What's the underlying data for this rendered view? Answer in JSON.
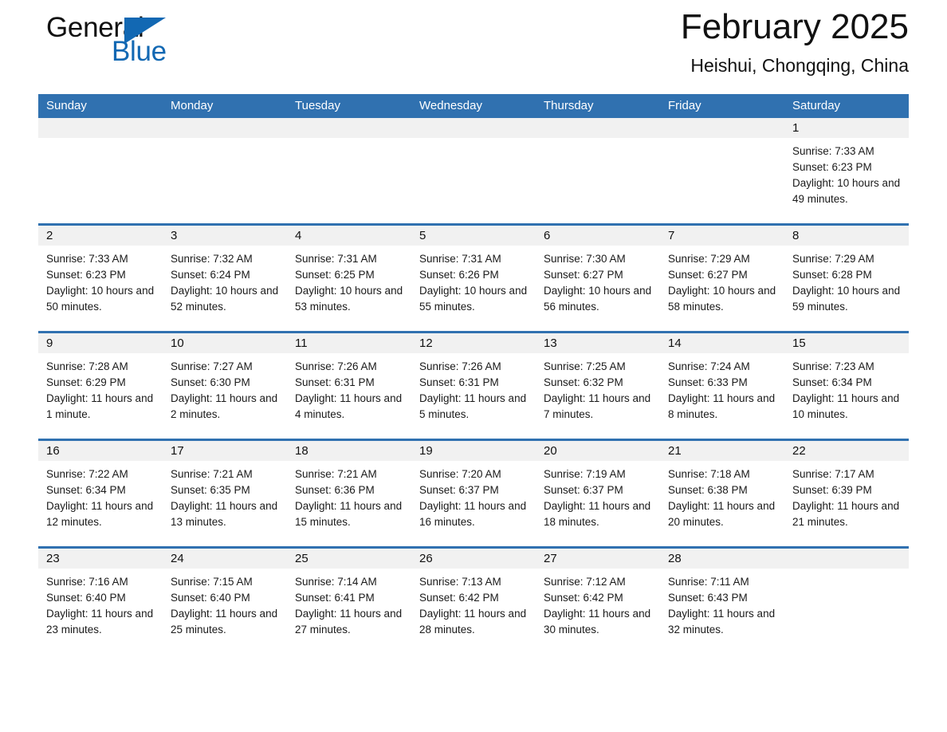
{
  "brand": {
    "name_dark": "General",
    "name_light": "Blue",
    "logo_icon": "blue-triangle-icon",
    "dark_color": "#111111",
    "blue_color": "#1268b3"
  },
  "header": {
    "month_title": "February 2025",
    "location": "Heishui, Chongqing, China"
  },
  "theme": {
    "header_blue": "#3071b0",
    "day_band_gray": "#f1f1f1",
    "text_color": "#1a1a1a"
  },
  "weekdays": [
    "Sunday",
    "Monday",
    "Tuesday",
    "Wednesday",
    "Thursday",
    "Friday",
    "Saturday"
  ],
  "weeks": [
    [
      {
        "day": "",
        "empty": true
      },
      {
        "day": "",
        "empty": true
      },
      {
        "day": "",
        "empty": true
      },
      {
        "day": "",
        "empty": true
      },
      {
        "day": "",
        "empty": true
      },
      {
        "day": "",
        "empty": true
      },
      {
        "day": "1",
        "sunrise": "Sunrise: 7:33 AM",
        "sunset": "Sunset: 6:23 PM",
        "daylight": "Daylight: 10 hours and 49 minutes."
      }
    ],
    [
      {
        "day": "2",
        "sunrise": "Sunrise: 7:33 AM",
        "sunset": "Sunset: 6:23 PM",
        "daylight": "Daylight: 10 hours and 50 minutes."
      },
      {
        "day": "3",
        "sunrise": "Sunrise: 7:32 AM",
        "sunset": "Sunset: 6:24 PM",
        "daylight": "Daylight: 10 hours and 52 minutes."
      },
      {
        "day": "4",
        "sunrise": "Sunrise: 7:31 AM",
        "sunset": "Sunset: 6:25 PM",
        "daylight": "Daylight: 10 hours and 53 minutes."
      },
      {
        "day": "5",
        "sunrise": "Sunrise: 7:31 AM",
        "sunset": "Sunset: 6:26 PM",
        "daylight": "Daylight: 10 hours and 55 minutes."
      },
      {
        "day": "6",
        "sunrise": "Sunrise: 7:30 AM",
        "sunset": "Sunset: 6:27 PM",
        "daylight": "Daylight: 10 hours and 56 minutes."
      },
      {
        "day": "7",
        "sunrise": "Sunrise: 7:29 AM",
        "sunset": "Sunset: 6:27 PM",
        "daylight": "Daylight: 10 hours and 58 minutes."
      },
      {
        "day": "8",
        "sunrise": "Sunrise: 7:29 AM",
        "sunset": "Sunset: 6:28 PM",
        "daylight": "Daylight: 10 hours and 59 minutes."
      }
    ],
    [
      {
        "day": "9",
        "sunrise": "Sunrise: 7:28 AM",
        "sunset": "Sunset: 6:29 PM",
        "daylight": "Daylight: 11 hours and 1 minute."
      },
      {
        "day": "10",
        "sunrise": "Sunrise: 7:27 AM",
        "sunset": "Sunset: 6:30 PM",
        "daylight": "Daylight: 11 hours and 2 minutes."
      },
      {
        "day": "11",
        "sunrise": "Sunrise: 7:26 AM",
        "sunset": "Sunset: 6:31 PM",
        "daylight": "Daylight: 11 hours and 4 minutes."
      },
      {
        "day": "12",
        "sunrise": "Sunrise: 7:26 AM",
        "sunset": "Sunset: 6:31 PM",
        "daylight": "Daylight: 11 hours and 5 minutes."
      },
      {
        "day": "13",
        "sunrise": "Sunrise: 7:25 AM",
        "sunset": "Sunset: 6:32 PM",
        "daylight": "Daylight: 11 hours and 7 minutes."
      },
      {
        "day": "14",
        "sunrise": "Sunrise: 7:24 AM",
        "sunset": "Sunset: 6:33 PM",
        "daylight": "Daylight: 11 hours and 8 minutes."
      },
      {
        "day": "15",
        "sunrise": "Sunrise: 7:23 AM",
        "sunset": "Sunset: 6:34 PM",
        "daylight": "Daylight: 11 hours and 10 minutes."
      }
    ],
    [
      {
        "day": "16",
        "sunrise": "Sunrise: 7:22 AM",
        "sunset": "Sunset: 6:34 PM",
        "daylight": "Daylight: 11 hours and 12 minutes."
      },
      {
        "day": "17",
        "sunrise": "Sunrise: 7:21 AM",
        "sunset": "Sunset: 6:35 PM",
        "daylight": "Daylight: 11 hours and 13 minutes."
      },
      {
        "day": "18",
        "sunrise": "Sunrise: 7:21 AM",
        "sunset": "Sunset: 6:36 PM",
        "daylight": "Daylight: 11 hours and 15 minutes."
      },
      {
        "day": "19",
        "sunrise": "Sunrise: 7:20 AM",
        "sunset": "Sunset: 6:37 PM",
        "daylight": "Daylight: 11 hours and 16 minutes."
      },
      {
        "day": "20",
        "sunrise": "Sunrise: 7:19 AM",
        "sunset": "Sunset: 6:37 PM",
        "daylight": "Daylight: 11 hours and 18 minutes."
      },
      {
        "day": "21",
        "sunrise": "Sunrise: 7:18 AM",
        "sunset": "Sunset: 6:38 PM",
        "daylight": "Daylight: 11 hours and 20 minutes."
      },
      {
        "day": "22",
        "sunrise": "Sunrise: 7:17 AM",
        "sunset": "Sunset: 6:39 PM",
        "daylight": "Daylight: 11 hours and 21 minutes."
      }
    ],
    [
      {
        "day": "23",
        "sunrise": "Sunrise: 7:16 AM",
        "sunset": "Sunset: 6:40 PM",
        "daylight": "Daylight: 11 hours and 23 minutes."
      },
      {
        "day": "24",
        "sunrise": "Sunrise: 7:15 AM",
        "sunset": "Sunset: 6:40 PM",
        "daylight": "Daylight: 11 hours and 25 minutes."
      },
      {
        "day": "25",
        "sunrise": "Sunrise: 7:14 AM",
        "sunset": "Sunset: 6:41 PM",
        "daylight": "Daylight: 11 hours and 27 minutes."
      },
      {
        "day": "26",
        "sunrise": "Sunrise: 7:13 AM",
        "sunset": "Sunset: 6:42 PM",
        "daylight": "Daylight: 11 hours and 28 minutes."
      },
      {
        "day": "27",
        "sunrise": "Sunrise: 7:12 AM",
        "sunset": "Sunset: 6:42 PM",
        "daylight": "Daylight: 11 hours and 30 minutes."
      },
      {
        "day": "28",
        "sunrise": "Sunrise: 7:11 AM",
        "sunset": "Sunset: 6:43 PM",
        "daylight": "Daylight: 11 hours and 32 minutes."
      },
      {
        "day": "",
        "empty": true
      }
    ]
  ]
}
